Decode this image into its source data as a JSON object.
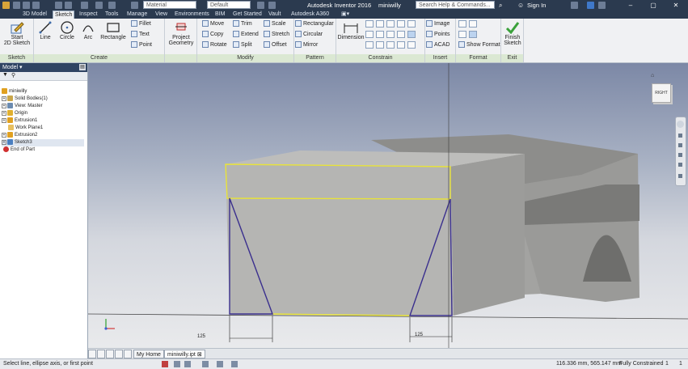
{
  "titlebar": {
    "material_combo": "Material",
    "appearance_combo": "Default",
    "app_title": "Autodesk Inventor 2016",
    "doc_title": "miniwilly",
    "search_placeholder": "Search Help & Commands...",
    "sign_in": "Sign In"
  },
  "tabs": [
    "3D Model",
    "Sketch",
    "Inspect",
    "Tools",
    "Manage",
    "View",
    "Environments",
    "BIM",
    "Get Started",
    "Vault",
    "Autodesk A360"
  ],
  "active_tab": "Sketch",
  "ribbon": {
    "sketch": {
      "start_label_1": "Start",
      "start_label_2": "2D Sketch",
      "group_label": "Sketch"
    },
    "create": {
      "line": "Line",
      "circle": "Circle",
      "arc": "Arc",
      "rectangle": "Rectangle",
      "fillet": "Fillet",
      "text": "Text",
      "point": "Point",
      "group_label": "Create"
    },
    "project": {
      "label_1": "Project",
      "label_2": "Geometry"
    },
    "modify": {
      "move": "Move",
      "copy": "Copy",
      "rotate": "Rotate",
      "trim": "Trim",
      "extend": "Extend",
      "split": "Split",
      "scale": "Scale",
      "stretch": "Stretch",
      "offset": "Offset",
      "group_label": "Modify"
    },
    "pattern": {
      "rectangular": "Rectangular",
      "circular": "Circular",
      "mirror": "Mirror",
      "group_label": "Pattern"
    },
    "constrain": {
      "dimension": "Dimension",
      "group_label": "Constrain"
    },
    "insert": {
      "image": "Image",
      "points": "Points",
      "acad": "ACAD",
      "group_label": "Insert"
    },
    "format": {
      "show_format": "Show Format",
      "group_label": "Format"
    },
    "exit": {
      "label_1": "Finish",
      "label_2": "Sketch",
      "group_label": "Exit"
    }
  },
  "browser": {
    "header": "Model",
    "items": [
      {
        "label": "miniwilly",
        "color": "#e0a020"
      },
      {
        "label": "Solid Bodies(1)",
        "color": "#c9a64a"
      },
      {
        "label": "View: Master",
        "color": "#6b8bb0"
      },
      {
        "label": "Origin",
        "color": "#e0b030"
      },
      {
        "label": "Extrusion1",
        "color": "#e0a020"
      },
      {
        "label": "Work Plane1",
        "color": "#e8c060"
      },
      {
        "label": "Extrusion2",
        "color": "#e0a020"
      },
      {
        "label": "Sketch3",
        "color": "#4a7fc0"
      },
      {
        "label": "End of Part",
        "color": "#d03030"
      }
    ]
  },
  "viewcube": {
    "face": "RIGHT"
  },
  "dimensions": {
    "left": "125",
    "right": "125"
  },
  "doctabs": {
    "home": "My Home",
    "file": "miniwilly.ipt"
  },
  "status": {
    "prompt": "Select line, ellipse axis, or first point",
    "coords": "116.336 mm, 565.147 mm",
    "constraint": "Fully Constrained",
    "count_a": "1",
    "count_b": "1"
  },
  "colors": {
    "accent_green": "#dbe8d3",
    "sketch_yellow": "#e8e33a",
    "sketch_blue": "#3a2f8e"
  }
}
